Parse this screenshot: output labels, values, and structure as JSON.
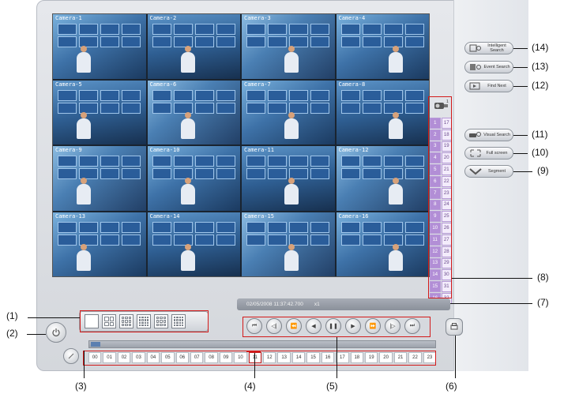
{
  "cameras": [
    {
      "label": "Camera-1"
    },
    {
      "label": "Camera-2"
    },
    {
      "label": "Camera-3"
    },
    {
      "label": "Camera-4"
    },
    {
      "label": "Camera-5"
    },
    {
      "label": "Camera-6"
    },
    {
      "label": "Camera-7"
    },
    {
      "label": "Camera-8"
    },
    {
      "label": "Camera-9"
    },
    {
      "label": "Camera-10"
    },
    {
      "label": "Camera-11"
    },
    {
      "label": "Camera-12"
    },
    {
      "label": "Camera-13"
    },
    {
      "label": "Camera-14"
    },
    {
      "label": "Camera-15"
    },
    {
      "label": "Camera-16"
    }
  ],
  "channels_left": [
    "1",
    "2",
    "3",
    "4",
    "5",
    "6",
    "7",
    "8",
    "9",
    "10",
    "11",
    "12",
    "13",
    "14",
    "15",
    "16"
  ],
  "channels_right": [
    "17",
    "18",
    "19",
    "20",
    "21",
    "22",
    "23",
    "24",
    "25",
    "26",
    "27",
    "28",
    "29",
    "30",
    "31",
    "32"
  ],
  "status": {
    "datetime": "02/05/2008 11:37:42.700",
    "speed": "x1"
  },
  "right_buttons": {
    "intelligent_search": "Intelligent Search",
    "event_search": "Event Search",
    "find_next": "Find Next",
    "visual_search": "Visual Search",
    "full_screen": "Full screen",
    "segment": "Segment"
  },
  "hours": [
    "00",
    "01",
    "02",
    "03",
    "04",
    "05",
    "06",
    "07",
    "08",
    "09",
    "10",
    "11",
    "12",
    "13",
    "14",
    "15",
    "16",
    "17",
    "18",
    "19",
    "20",
    "21",
    "22",
    "23"
  ],
  "selected_hour": "11",
  "playback_icons": [
    "skip-to-start-icon",
    "step-back-icon",
    "fast-rewind-icon",
    "play-reverse-icon",
    "pause-icon",
    "play-icon",
    "fast-forward-icon",
    "step-forward-icon",
    "skip-to-end-icon"
  ],
  "callouts": {
    "c1": "(1)",
    "c2": "(2)",
    "c3": "(3)",
    "c4": "(4)",
    "c5": "(5)",
    "c6": "(6)",
    "c7": "(7)",
    "c8": "(8)",
    "c9": "(9)",
    "c10": "(10)",
    "c11": "(11)",
    "c12": "(12)",
    "c13": "(13)",
    "c14": "(14)"
  },
  "colors": {
    "callout_box": "#d31a1a",
    "channel_active": "#b28ed6"
  }
}
